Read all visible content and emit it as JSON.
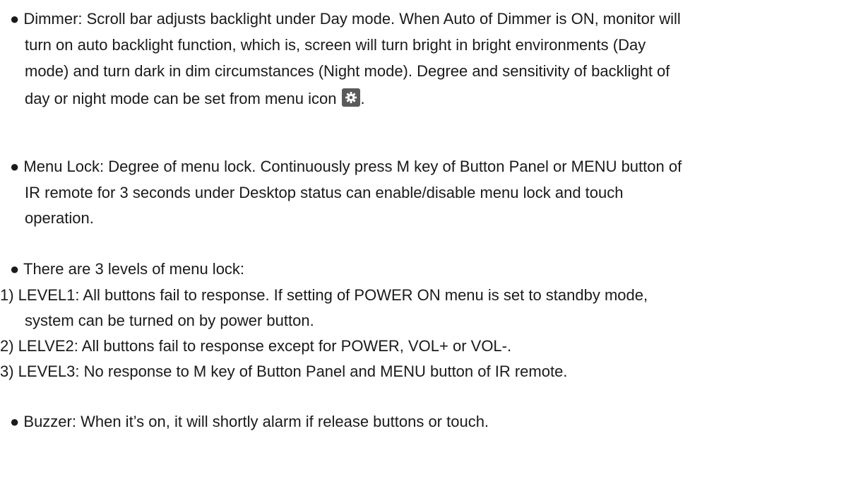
{
  "dimmer": {
    "line1": "● Dimmer: Scroll bar adjusts backlight under Day mode. When Auto of Dimmer is ON, monitor will",
    "line2": "turn on auto backlight function, which is, screen will turn bright in bright environments (Day",
    "line3": "mode) and turn dark in dim circumstances (Night mode). Degree and sensitivity of backlight of",
    "line4": "day or night mode can be set from menu icon",
    "line4_end": ".",
    "icon": "gear-icon"
  },
  "menu_lock": {
    "line1": "● Menu Lock: Degree of menu lock. Continuously press M key of Button Panel or MENU button of",
    "line2": "IR remote for 3 seconds under Desktop status can enable/disable menu lock and touch",
    "line3": "operation."
  },
  "levels": {
    "intro": "● There are 3 levels of menu lock:",
    "level1_line1": "1) LEVEL1: All buttons fail to response. If setting of POWER ON menu is set to standby mode,",
    "level1_line2": "system can be turned on by power button.",
    "level2": "2) LELVE2: All buttons fail to response except for POWER, VOL+ or VOL-.",
    "level3": "3) LEVEL3: No response to M key of Button Panel and MENU button of IR remote."
  },
  "buzzer": {
    "line1": "● Buzzer: When it’s on, it will shortly alarm if release buttons or touch."
  },
  "colors": {
    "text": "#1a1a1a",
    "icon_bg": "#5a5a5a",
    "icon_fg": "#ffffff"
  }
}
